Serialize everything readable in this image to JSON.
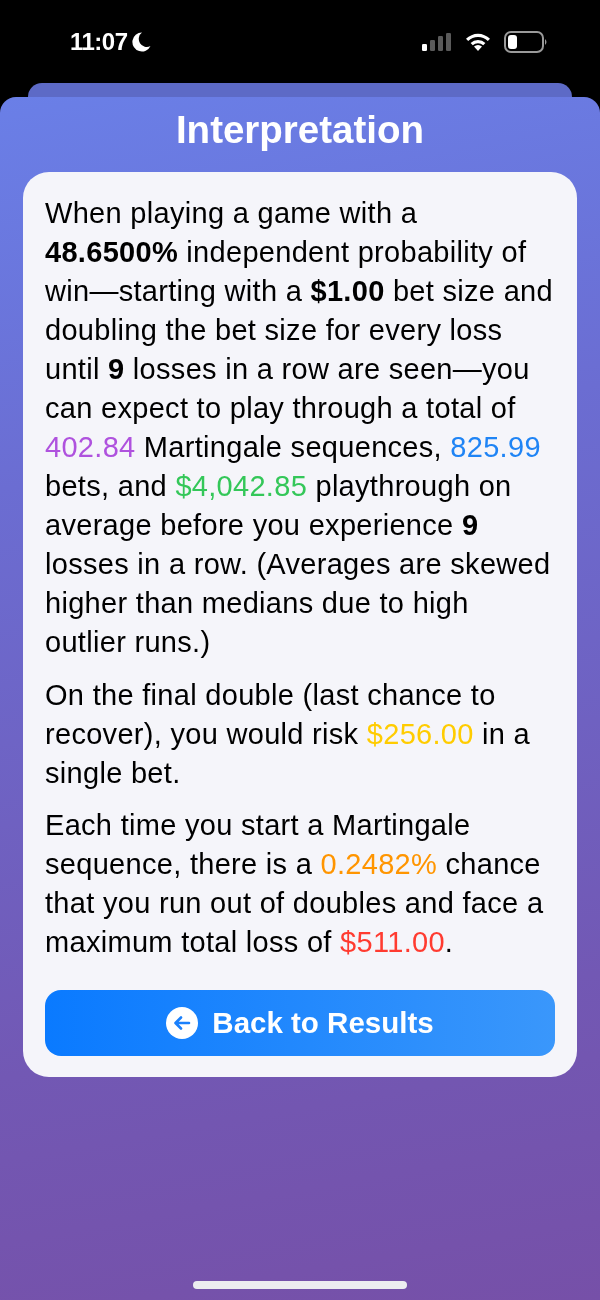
{
  "status_bar": {
    "time": "11:07"
  },
  "title": "Interpretation",
  "paragraphs": [
    {
      "segments": [
        {
          "kind": "plain",
          "text": "When playing a game with a "
        },
        {
          "kind": "bold",
          "text": "48.6500%"
        },
        {
          "kind": "plain",
          "text": " independent probability of win—starting with a "
        },
        {
          "kind": "bold",
          "text": "$1.00"
        },
        {
          "kind": "plain",
          "text": " bet size and doubling the bet size for every loss until "
        },
        {
          "kind": "bold",
          "text": "9"
        },
        {
          "kind": "plain",
          "text": " losses in a row are seen—you can expect to play through a total of "
        },
        {
          "kind": "value",
          "text": "402.84",
          "color": "#af52de"
        },
        {
          "kind": "plain",
          "text": " Martingale sequences, "
        },
        {
          "kind": "value",
          "text": "825.99",
          "color": "#1f84f5"
        },
        {
          "kind": "plain",
          "text": " bets, and "
        },
        {
          "kind": "value",
          "text": "$4,042.85",
          "color": "#34c759"
        },
        {
          "kind": "plain",
          "text": " playthrough on average before you experience "
        },
        {
          "kind": "bold",
          "text": "9"
        },
        {
          "kind": "plain",
          "text": " losses in a row. (Averages are skewed higher than medians due to high outlier runs.)"
        }
      ]
    },
    {
      "segments": [
        {
          "kind": "plain",
          "text": "On the final double (last chance to recover), you would risk "
        },
        {
          "kind": "value",
          "text": "$256.00",
          "color": "#ffcc00"
        },
        {
          "kind": "plain",
          "text": " in a single bet."
        }
      ]
    },
    {
      "segments": [
        {
          "kind": "plain",
          "text": "Each time you start a Martingale sequence, there is a "
        },
        {
          "kind": "value",
          "text": "0.2482%",
          "color": "#ff9500"
        },
        {
          "kind": "plain",
          "text": " chance that you run out of doubles and face a maximum total loss of "
        },
        {
          "kind": "value",
          "text": "$511.00",
          "color": "#ff3b30"
        },
        {
          "kind": "plain",
          "text": "."
        }
      ]
    }
  ],
  "button": {
    "label": "Back to Results"
  }
}
